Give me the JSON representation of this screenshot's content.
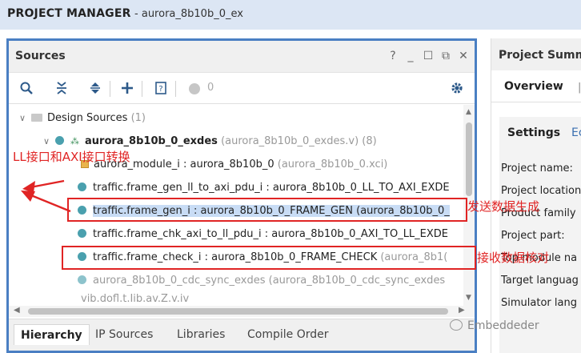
{
  "header": {
    "title": "PROJECT MANAGER",
    "subtitle": "- aurora_8b10b_0_ex"
  },
  "sources": {
    "title": "Sources",
    "window_controls": {
      "help": "?",
      "minimize": "_",
      "restore": "☐",
      "float": "⧉",
      "close": "✕"
    },
    "toolbar": {
      "problem_count": "0"
    },
    "tree": {
      "design_sources": {
        "label": "Design Sources",
        "count": "(1)"
      },
      "top": {
        "name": "aurora_8b10b_0_exdes",
        "file": "(aurora_8b10b_0_exdes.v)",
        "count": "(8)"
      },
      "rows": [
        {
          "name": "aurora_module_i : aurora_8b10b_0",
          "file": "(aurora_8b10b_0.xci)"
        },
        {
          "name": "traffic.frame_gen_ll_to_axi_pdu_i : aurora_8b10b_0_LL_TO_AXI_EXDE",
          "file": ""
        },
        {
          "name": "traffic.frame_gen_i : aurora_8b10b_0_FRAME_GEN (aurora_8b10b_0_",
          "file": ""
        },
        {
          "name": "traffic.frame_chk_axi_to_ll_pdu_i : aurora_8b10b_0_AXI_TO_LL_EXDE",
          "file": ""
        },
        {
          "name": "traffic.frame_check_i : aurora_8b10b_0_FRAME_CHECK",
          "file": "(aurora_8b1("
        },
        {
          "name": "aurora_8b10b_0_cdc_sync_exdes (aurora_8b10b_0_cdc_sync_exdes",
          "file": ""
        },
        {
          "name": "vib.dofl.t.Iib.av.Z.v.iv",
          "file": ""
        }
      ]
    },
    "tabs": [
      "Hierarchy",
      "IP Sources",
      "Libraries",
      "Compile Order"
    ]
  },
  "summary": {
    "title": "Project Summa",
    "tab_overview": "Overview",
    "tab_sep": "|",
    "section": "Settings",
    "edit": "Ec",
    "labels": [
      "Project name:",
      "Project location",
      "Product family",
      "Project part:",
      "Top module na",
      "Target languag",
      "Simulator lang"
    ]
  },
  "annotations": {
    "ll_axi": "LL接口和AXI接口转换",
    "send_gen": "发送数据生成",
    "recv_check": "接收数据核对"
  },
  "watermark": "Embeddeder",
  "colors": {
    "accent": "#4a7fc3",
    "annotation": "#e02424",
    "selection": "#c8dcf5",
    "top_bar": "#dce6f4"
  }
}
